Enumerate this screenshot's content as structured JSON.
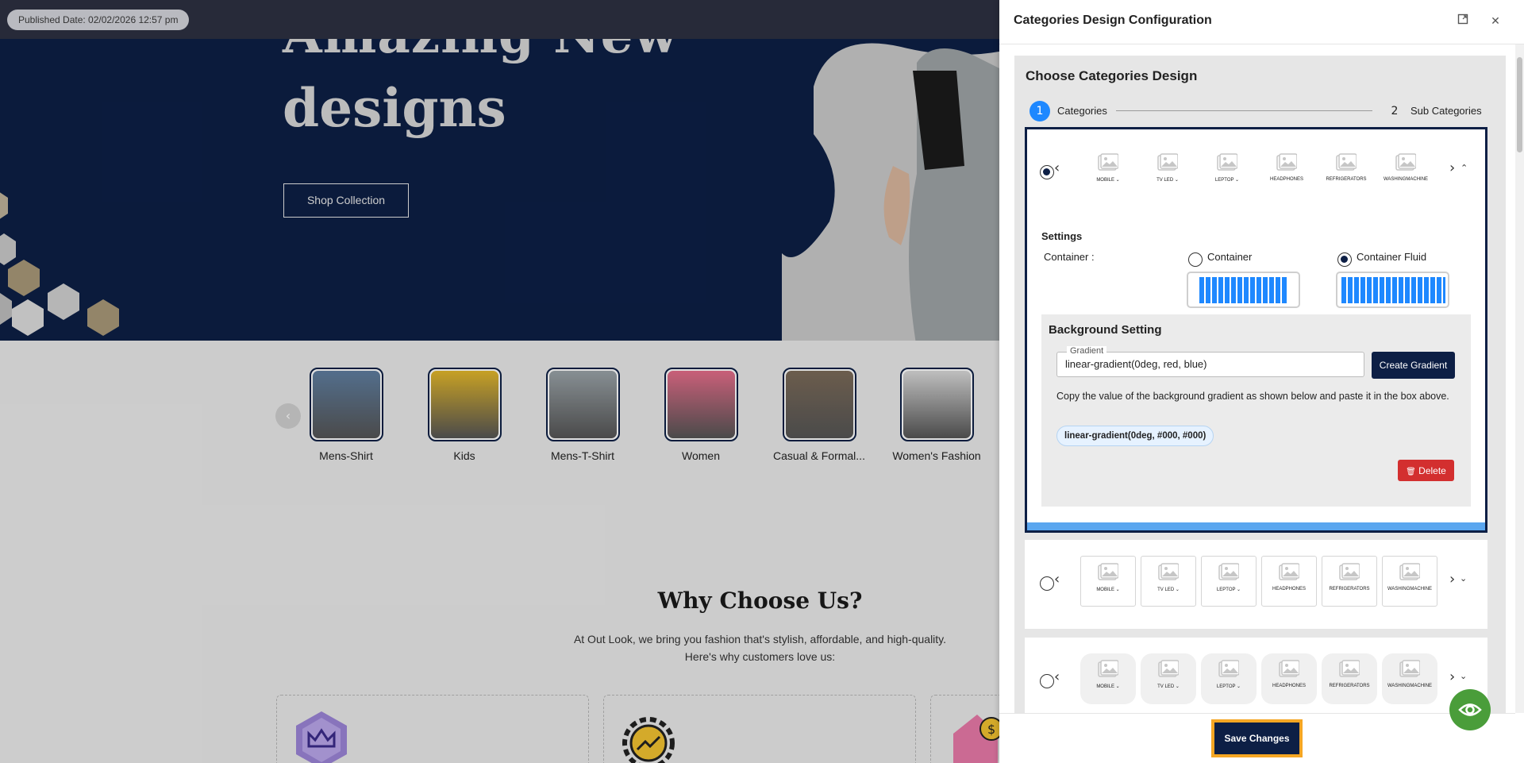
{
  "storefront": {
    "published_badge": "Published Date: 02/02/2026 12:57 pm",
    "hero": {
      "title_partial": "Amazing New",
      "title": "designs",
      "cta_label": "Shop Collection"
    },
    "categories": [
      {
        "label": "Mens-Shirt",
        "color": "#5f7ea0"
      },
      {
        "label": "Kids",
        "color": "#e3b72a"
      },
      {
        "label": "Mens-T-Shirt",
        "color": "#9aa3a8"
      },
      {
        "label": "Women",
        "color": "#e56d8a"
      },
      {
        "label": "Casual & Formal...",
        "color": "#7b6a58"
      },
      {
        "label": "Women's Fashion",
        "color": "#d9d9d9"
      }
    ],
    "why": {
      "title": "Why Choose Us?",
      "subtitle_line1": "At Out Look, we bring you fashion that's stylish, affordable, and high-quality.",
      "subtitle_line2": "Here's why customers love us:"
    }
  },
  "panel": {
    "title": "Categories Design Configuration",
    "header_icons": [
      "expand-icon",
      "close-icon"
    ],
    "close_glyph": "✕",
    "section_title": "Choose Categories Design",
    "steps": [
      {
        "number": "1",
        "label": "Categories",
        "active": true
      },
      {
        "number": "2",
        "label": "Sub Categories",
        "active": false
      }
    ],
    "mini_categories": [
      {
        "label": "MOBILE ⌄"
      },
      {
        "label": "TV LED ⌄"
      },
      {
        "label": "LEPTOP ⌄"
      },
      {
        "label": "HEADPHONES"
      },
      {
        "label": "REFRIGERATORS"
      },
      {
        "label": "WASHINGMACHINE"
      }
    ],
    "settings": {
      "title": "Settings",
      "container_label": "Container :",
      "option_container": "Container",
      "option_container_fluid": "Container Fluid",
      "selected": "Container Fluid"
    },
    "background": {
      "title": "Background Setting",
      "field_legend": "Gradient",
      "field_value": "linear-gradient(0deg, red, blue)",
      "create_label": "Create Gradient",
      "instructions": "Copy the value of the background gradient as shown below and paste it in the box above.",
      "sample": "linear-gradient(0deg, #000, #000)",
      "delete_label": "Delete"
    },
    "save_label": "Save Changes"
  },
  "colors": {
    "navy": "#0d1f45",
    "step_active": "#1e88ff",
    "accent_orange": "#f5a623",
    "delete_red": "#d32f2f",
    "fab_green": "#4a9d3a"
  }
}
